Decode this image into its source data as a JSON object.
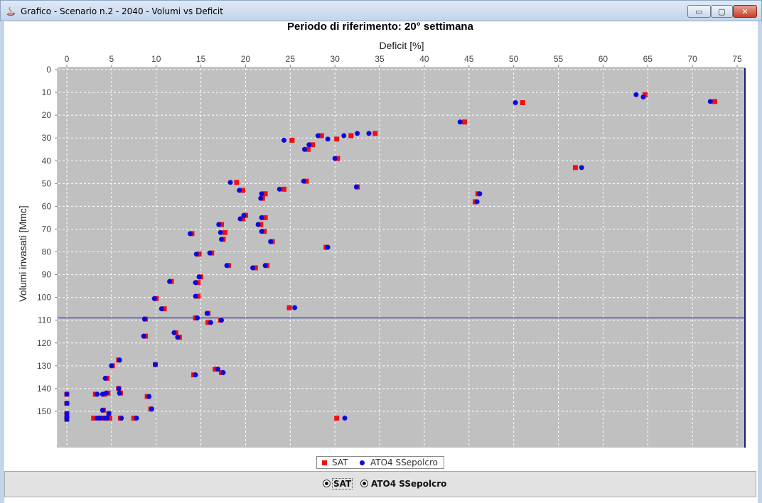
{
  "window": {
    "title": "Grafico - Scenario n.2 - 2040 - Volumi vs Deficit",
    "controls": {
      "minimize": "▭",
      "maximize": "▢",
      "close": "✕"
    }
  },
  "chart_data": {
    "type": "scatter",
    "title": "Periodo di riferimento:  20° settimana",
    "xlabel": "Deficit [%]",
    "ylabel": "Volumi invasati [Mmc]",
    "xlim": [
      0,
      75
    ],
    "ylim": [
      0,
      160
    ],
    "y_inverted": true,
    "x_axis_position": "top",
    "x_ticks": [
      0,
      5,
      10,
      15,
      20,
      25,
      30,
      35,
      40,
      45,
      50,
      55,
      60,
      65,
      70,
      75
    ],
    "y_ticks": [
      0,
      10,
      20,
      30,
      40,
      50,
      60,
      70,
      80,
      90,
      100,
      110,
      120,
      130,
      140,
      150
    ],
    "grid": true,
    "plot_background": "#c0c0c0",
    "reference_line": {
      "y": 109,
      "color": "#3030b0"
    },
    "legend_position": "bottom-center",
    "series": [
      {
        "name": "SAT",
        "marker": "square",
        "color": "#ee1111",
        "points": [
          [
            72.5,
            14
          ],
          [
            64.7,
            11
          ],
          [
            51,
            14.5
          ],
          [
            44.5,
            23
          ],
          [
            34.5,
            28
          ],
          [
            31.8,
            29
          ],
          [
            30.2,
            30.5
          ],
          [
            28.5,
            29
          ],
          [
            27.5,
            33
          ],
          [
            27,
            35
          ],
          [
            25.2,
            31
          ],
          [
            30.3,
            39
          ],
          [
            26.8,
            49
          ],
          [
            19,
            49.5
          ],
          [
            24.3,
            52.5
          ],
          [
            19.7,
            53
          ],
          [
            32.5,
            51.5
          ],
          [
            22.2,
            54.5
          ],
          [
            21.9,
            56.5
          ],
          [
            46,
            54.5
          ],
          [
            45.7,
            58
          ],
          [
            20,
            64
          ],
          [
            22.2,
            65
          ],
          [
            19.7,
            65.5
          ],
          [
            21.7,
            68
          ],
          [
            17.3,
            68
          ],
          [
            17.7,
            71.5
          ],
          [
            14,
            72
          ],
          [
            22.1,
            71
          ],
          [
            17.5,
            74.5
          ],
          [
            23,
            75.5
          ],
          [
            56.9,
            43
          ],
          [
            29,
            78
          ],
          [
            14.8,
            81
          ],
          [
            16.2,
            80.5
          ],
          [
            18.1,
            86
          ],
          [
            21.1,
            87
          ],
          [
            22.4,
            86
          ],
          [
            15,
            91
          ],
          [
            11.7,
            93
          ],
          [
            14.7,
            93.5
          ],
          [
            10,
            100.5
          ],
          [
            14.7,
            99.5
          ],
          [
            10.9,
            105
          ],
          [
            24.9,
            104.5
          ],
          [
            15.8,
            107
          ],
          [
            14.4,
            109
          ],
          [
            8.8,
            109.5
          ],
          [
            15.8,
            111
          ],
          [
            17.2,
            110
          ],
          [
            12.2,
            115.5
          ],
          [
            12.6,
            117.5
          ],
          [
            8.8,
            117
          ],
          [
            5.8,
            127.5
          ],
          [
            5.1,
            130
          ],
          [
            9.9,
            129.5
          ],
          [
            16.6,
            131.5
          ],
          [
            17.3,
            133
          ],
          [
            14.2,
            134
          ],
          [
            4.5,
            135.5
          ],
          [
            5.8,
            140
          ],
          [
            6,
            142
          ],
          [
            0,
            142.5
          ],
          [
            3.2,
            142.5
          ],
          [
            4.2,
            142.5
          ],
          [
            4.6,
            142
          ],
          [
            9,
            143.5
          ],
          [
            0,
            146.5
          ],
          [
            4.1,
            149.5
          ],
          [
            9.4,
            149
          ],
          [
            0,
            151
          ],
          [
            0,
            152.5
          ],
          [
            0,
            153.5
          ],
          [
            4.7,
            151
          ],
          [
            3,
            153
          ],
          [
            3.8,
            153
          ],
          [
            4.3,
            153
          ],
          [
            6,
            153
          ],
          [
            7.5,
            153
          ],
          [
            4.8,
            153
          ],
          [
            30.2,
            153
          ]
        ]
      },
      {
        "name": "ATO4 SSepolcro",
        "marker": "circle",
        "color": "#0a0ae0",
        "points": [
          [
            72,
            14
          ],
          [
            63.7,
            11
          ],
          [
            64.5,
            12
          ],
          [
            50.2,
            14.5
          ],
          [
            44,
            23
          ],
          [
            33.8,
            28
          ],
          [
            32.5,
            28
          ],
          [
            31,
            29
          ],
          [
            29.2,
            30.5
          ],
          [
            28.1,
            29
          ],
          [
            27.1,
            33
          ],
          [
            26.6,
            35
          ],
          [
            24.3,
            31
          ],
          [
            30,
            39
          ],
          [
            26.5,
            49
          ],
          [
            18.3,
            49.5
          ],
          [
            23.8,
            52.5
          ],
          [
            19.3,
            53
          ],
          [
            32.4,
            51.5
          ],
          [
            21.8,
            54.5
          ],
          [
            21.7,
            56.5
          ],
          [
            46.2,
            54.5
          ],
          [
            45.9,
            58
          ],
          [
            19.8,
            64
          ],
          [
            21.8,
            65
          ],
          [
            19.4,
            65.5
          ],
          [
            21.4,
            68
          ],
          [
            17,
            68
          ],
          [
            17.2,
            71.5
          ],
          [
            13.8,
            72
          ],
          [
            21.8,
            71
          ],
          [
            17.3,
            74.5
          ],
          [
            22.8,
            75.5
          ],
          [
            57.6,
            43
          ],
          [
            29.2,
            78
          ],
          [
            14.5,
            81
          ],
          [
            16,
            80.5
          ],
          [
            17.9,
            86
          ],
          [
            20.8,
            87
          ],
          [
            22.2,
            86
          ],
          [
            14.8,
            91
          ],
          [
            11.5,
            93
          ],
          [
            14.4,
            93.5
          ],
          [
            9.8,
            100.5
          ],
          [
            14.4,
            99.5
          ],
          [
            10.6,
            105
          ],
          [
            25.5,
            104.5
          ],
          [
            15.7,
            107
          ],
          [
            14.6,
            109
          ],
          [
            8.7,
            109.5
          ],
          [
            16.1,
            111
          ],
          [
            17.3,
            110
          ],
          [
            12,
            115.5
          ],
          [
            12.4,
            117.5
          ],
          [
            8.6,
            117
          ],
          [
            5.9,
            127.5
          ],
          [
            5,
            130
          ],
          [
            9.9,
            129.5
          ],
          [
            16.9,
            131.5
          ],
          [
            17.5,
            133
          ],
          [
            14.4,
            134
          ],
          [
            4.3,
            135.5
          ],
          [
            5.8,
            140
          ],
          [
            5.9,
            142
          ],
          [
            0,
            142.5
          ],
          [
            3.4,
            142.5
          ],
          [
            4,
            142.5
          ],
          [
            4.4,
            142
          ],
          [
            9.2,
            143.5
          ],
          [
            0,
            146.5
          ],
          [
            4,
            149.5
          ],
          [
            9.5,
            149
          ],
          [
            0,
            151
          ],
          [
            0,
            152.5
          ],
          [
            0,
            153.5
          ],
          [
            4.7,
            151
          ],
          [
            3.4,
            153
          ],
          [
            3.7,
            153
          ],
          [
            4.2,
            153
          ],
          [
            4.5,
            153
          ],
          [
            7.8,
            153
          ],
          [
            6.1,
            153
          ],
          [
            31.1,
            153
          ]
        ]
      }
    ]
  },
  "legend": {
    "sat_label": "SAT",
    "ato_label": "ATO4 SSepolcro"
  },
  "selector": {
    "option_sat": "SAT",
    "option_ato": "ATO4 SSepolcro"
  }
}
